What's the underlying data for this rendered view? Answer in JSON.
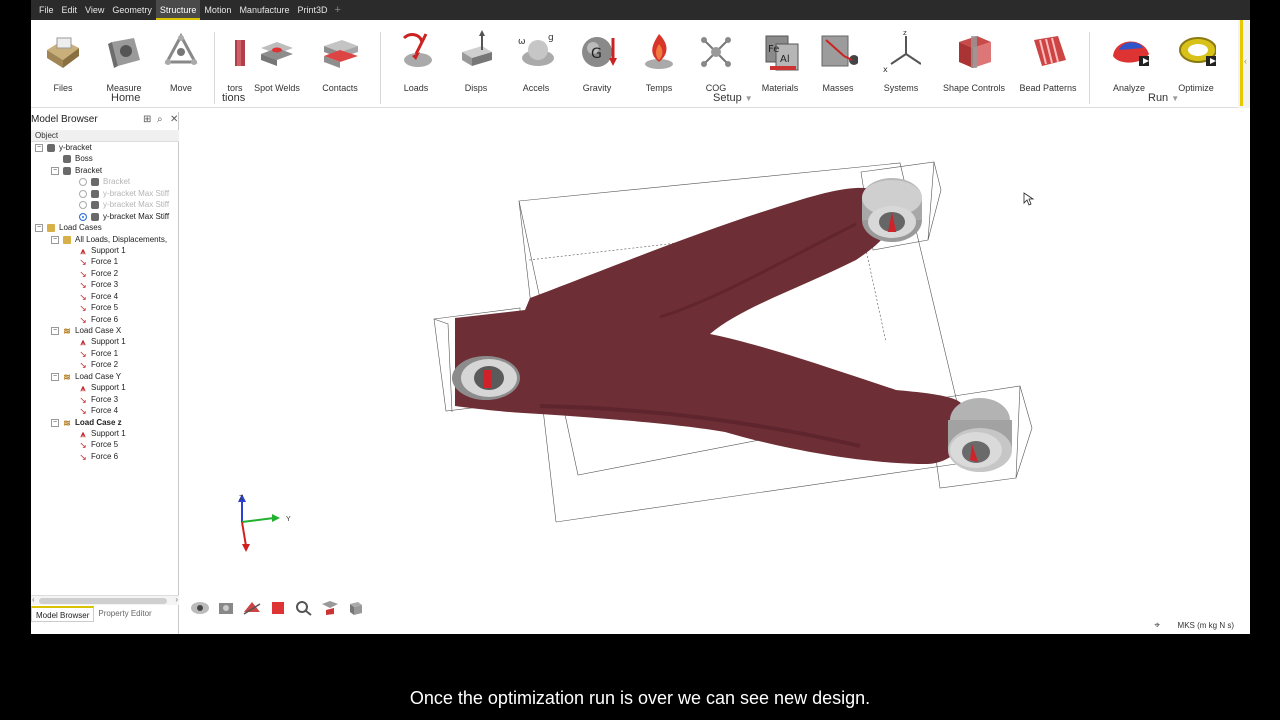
{
  "menu": [
    "File",
    "Edit",
    "View",
    "Geometry",
    "Structure",
    "Motion",
    "Manufacture",
    "Print3D"
  ],
  "menu_active": "Structure",
  "ribbon": {
    "tools": {
      "files": "Files",
      "measure": "Measure",
      "move": "Move",
      "connectors": "tors",
      "spot_welds": "Spot Welds",
      "contacts": "Contacts",
      "loads": "Loads",
      "disps": "Disps",
      "accels": "Accels",
      "gravity": "Gravity",
      "temps": "Temps",
      "cog": "COG",
      "materials": "Materials",
      "masses": "Masses",
      "systems": "Systems",
      "shape_controls": "Shape Controls",
      "bead_patterns": "Bead Patterns",
      "analyze": "Analyze",
      "optimize": "Optimize"
    },
    "groups": {
      "home": "Home",
      "connections": "tions",
      "setup": "Setup",
      "run": "Run"
    }
  },
  "browser": {
    "title": "Model Browser",
    "column": "Object",
    "tree": [
      {
        "label": "y-bracket",
        "level": 0,
        "toggle": "−",
        "icon": "part"
      },
      {
        "label": "Boss",
        "level": 1,
        "icon": "part"
      },
      {
        "label": "Bracket",
        "level": 1,
        "toggle": "−",
        "icon": "part"
      },
      {
        "label": "Bracket",
        "level": 2,
        "radio": "off",
        "icon": "part",
        "dim": true
      },
      {
        "label": "y-bracket Max Stiff",
        "level": 2,
        "radio": "off",
        "icon": "part",
        "dim": true
      },
      {
        "label": "y-bracket Max Stiff",
        "level": 2,
        "radio": "off",
        "icon": "part",
        "dim": true
      },
      {
        "label": "y-bracket Max Stiff",
        "level": 2,
        "radio": "on",
        "icon": "part"
      },
      {
        "label": "Load Cases",
        "level": 0,
        "toggle": "−",
        "icon": "folder"
      },
      {
        "label": "All Loads, Displacements,",
        "level": 1,
        "toggle": "−",
        "icon": "folder"
      },
      {
        "label": "Support 1",
        "level": 2,
        "icon": "support"
      },
      {
        "label": "Force 1",
        "level": 2,
        "icon": "force"
      },
      {
        "label": "Force 2",
        "level": 2,
        "icon": "force"
      },
      {
        "label": "Force 3",
        "level": 2,
        "icon": "force"
      },
      {
        "label": "Force 4",
        "level": 2,
        "icon": "force"
      },
      {
        "label": "Force 5",
        "level": 2,
        "icon": "force"
      },
      {
        "label": "Force 6",
        "level": 2,
        "icon": "force"
      },
      {
        "label": "Load Case X",
        "level": 1,
        "toggle": "−",
        "icon": "loadcase"
      },
      {
        "label": "Support 1",
        "level": 2,
        "icon": "support"
      },
      {
        "label": "Force 1",
        "level": 2,
        "icon": "force"
      },
      {
        "label": "Force 2",
        "level": 2,
        "icon": "force"
      },
      {
        "label": "Load Case Y",
        "level": 1,
        "toggle": "−",
        "icon": "loadcase"
      },
      {
        "label": "Support 1",
        "level": 2,
        "icon": "support"
      },
      {
        "label": "Force 3",
        "level": 2,
        "icon": "force"
      },
      {
        "label": "Force 4",
        "level": 2,
        "icon": "force"
      },
      {
        "label": "Load Case z",
        "level": 1,
        "toggle": "−",
        "icon": "loadcase",
        "bold": true
      },
      {
        "label": "Support 1",
        "level": 2,
        "icon": "support"
      },
      {
        "label": "Force 5",
        "level": 2,
        "icon": "force"
      },
      {
        "label": "Force 6",
        "level": 2,
        "icon": "force"
      }
    ],
    "tabs": [
      "Model Browser",
      "Property Editor"
    ]
  },
  "viewport": {
    "units": "MKS (m kg N s)",
    "triad": {
      "z": "Z",
      "y": "Y"
    },
    "part_color": "#6e2e35"
  },
  "caption": "Once the optimization run is over we can see new design."
}
